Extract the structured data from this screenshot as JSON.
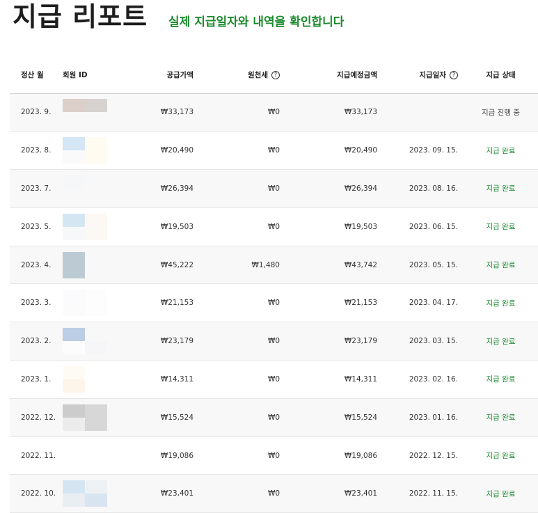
{
  "header": {
    "title": "지급 리포트",
    "subtitle": "실제 지급일자와 내역을 확인합니다"
  },
  "table": {
    "columns": {
      "month": "정산 월",
      "member_id": "회원 ID",
      "supply": "공급가액",
      "tax": "원천세",
      "expected": "지급예정금액",
      "date": "지급일자",
      "status": "지급 상태"
    },
    "help_icon": "question-circle-icon",
    "rows": [
      {
        "month": "2023. 9.",
        "supply": "₩33,173",
        "tax": "₩0",
        "expected": "₩33,173",
        "date": "",
        "status": "지급 진행 중",
        "status_type": "progress",
        "blur": [
          "#dccfca",
          "#d6d2d0",
          "#f8f8f8",
          "#f8f8f8"
        ]
      },
      {
        "month": "2023. 8.",
        "supply": "₩20,490",
        "tax": "₩0",
        "expected": "₩20,490",
        "date": "2023. 09. 15.",
        "status": "지급 완료",
        "status_type": "done",
        "blur": [
          "#d4e6f4",
          "#fefbf1",
          "#fafafa",
          "#fefbf1"
        ]
      },
      {
        "month": "2023. 7.",
        "supply": "₩26,394",
        "tax": "₩0",
        "expected": "₩26,394",
        "date": "2023. 08. 16.",
        "status": "지급 완료",
        "status_type": "done",
        "blur": [
          "#f5f7f8",
          "#f8f8f8",
          "#f8f8f8",
          "#f8f8f8"
        ]
      },
      {
        "month": "2023. 5.",
        "supply": "₩19,503",
        "tax": "₩0",
        "expected": "₩19,503",
        "date": "2023. 06. 15.",
        "status": "지급 완료",
        "status_type": "done",
        "blur": [
          "#d5e6f3",
          "#fdf8f3",
          "#f6f8f9",
          "#fcf8f4"
        ]
      },
      {
        "month": "2023. 4.",
        "supply": "₩45,222",
        "tax": "₩1,480",
        "expected": "₩43,742",
        "date": "2023. 05. 15.",
        "status": "지급 완료",
        "status_type": "done",
        "blur": [
          "#bccbd3",
          "#f8f8f8",
          "#bccbd3",
          "#f8f8f8"
        ]
      },
      {
        "month": "2023. 3.",
        "supply": "₩21,153",
        "tax": "₩0",
        "expected": "₩21,153",
        "date": "2023. 04. 17.",
        "status": "지급 완료",
        "status_type": "done",
        "blur": [
          "#fbfbfd",
          "#fdfdfd",
          "#fbfbfc",
          "#fdfdfd"
        ]
      },
      {
        "month": "2023. 2.",
        "supply": "₩23,179",
        "tax": "₩0",
        "expected": "₩23,179",
        "date": "2023. 03. 15.",
        "status": "지급 완료",
        "status_type": "done",
        "blur": [
          "#bccde6",
          "#f8f8f8",
          "#fcfcfd",
          "#f6f6f8"
        ]
      },
      {
        "month": "2023. 1.",
        "supply": "₩14,311",
        "tax": "₩0",
        "expected": "₩14,311",
        "date": "2023. 02. 16.",
        "status": "지급 완료",
        "status_type": "done",
        "blur": [
          "#fefaf4",
          "#ffffff",
          "#fef5ea",
          "#ffffff"
        ]
      },
      {
        "month": "2022. 12.",
        "supply": "₩15,524",
        "tax": "₩0",
        "expected": "₩15,524",
        "date": "2023. 01. 16.",
        "status": "지급 완료",
        "status_type": "done",
        "blur": [
          "#cccccc",
          "#d7d7d7",
          "#ececec",
          "#d7d7d7"
        ]
      },
      {
        "month": "2022. 11.",
        "supply": "₩19,086",
        "tax": "₩0",
        "expected": "₩19,086",
        "date": "2022. 12. 15.",
        "status": "지급 완료",
        "status_type": "done",
        "blur": [
          "#ffffff",
          "#ffffff",
          "#ffffff",
          "#ffffff"
        ]
      },
      {
        "month": "2022. 10.",
        "supply": "₩23,401",
        "tax": "₩0",
        "expected": "₩23,401",
        "date": "2022. 11. 15.",
        "status": "지급 완료",
        "status_type": "done",
        "blur": [
          "#d5e6f2",
          "#eef1f4",
          "#e9eef2",
          "#d8e4ef"
        ]
      }
    ]
  },
  "colors": {
    "accent_green": "#1b8a2c",
    "row_alt": "#f8f8f8",
    "border": "#e6e6e6"
  }
}
